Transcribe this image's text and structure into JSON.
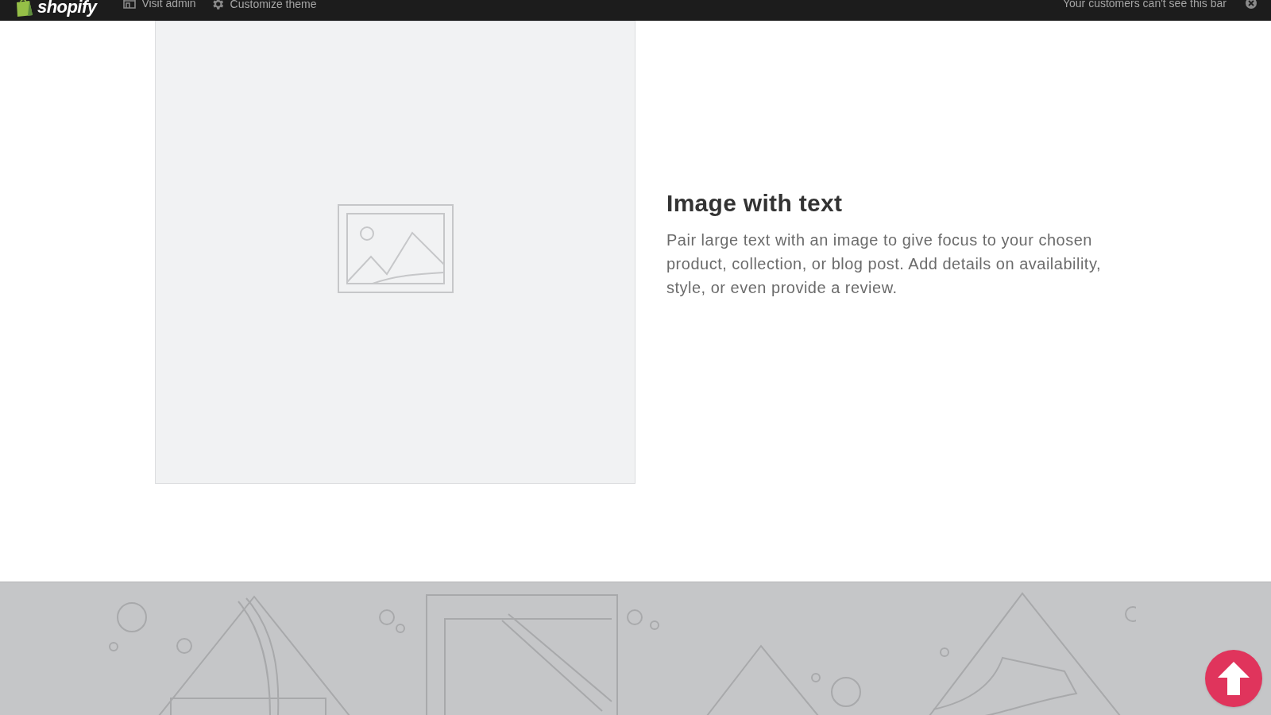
{
  "admin_bar": {
    "logo": "shopify",
    "links": [
      {
        "label": "Visit admin"
      },
      {
        "label": "Customize theme"
      }
    ],
    "notice": "Your customers can't see this bar"
  },
  "image_with_text": {
    "heading": "Image with text",
    "body": "Pair large text with an image to give focus to your chosen product, collection, or blog post. Add details on availability, style, or even provide a review."
  }
}
